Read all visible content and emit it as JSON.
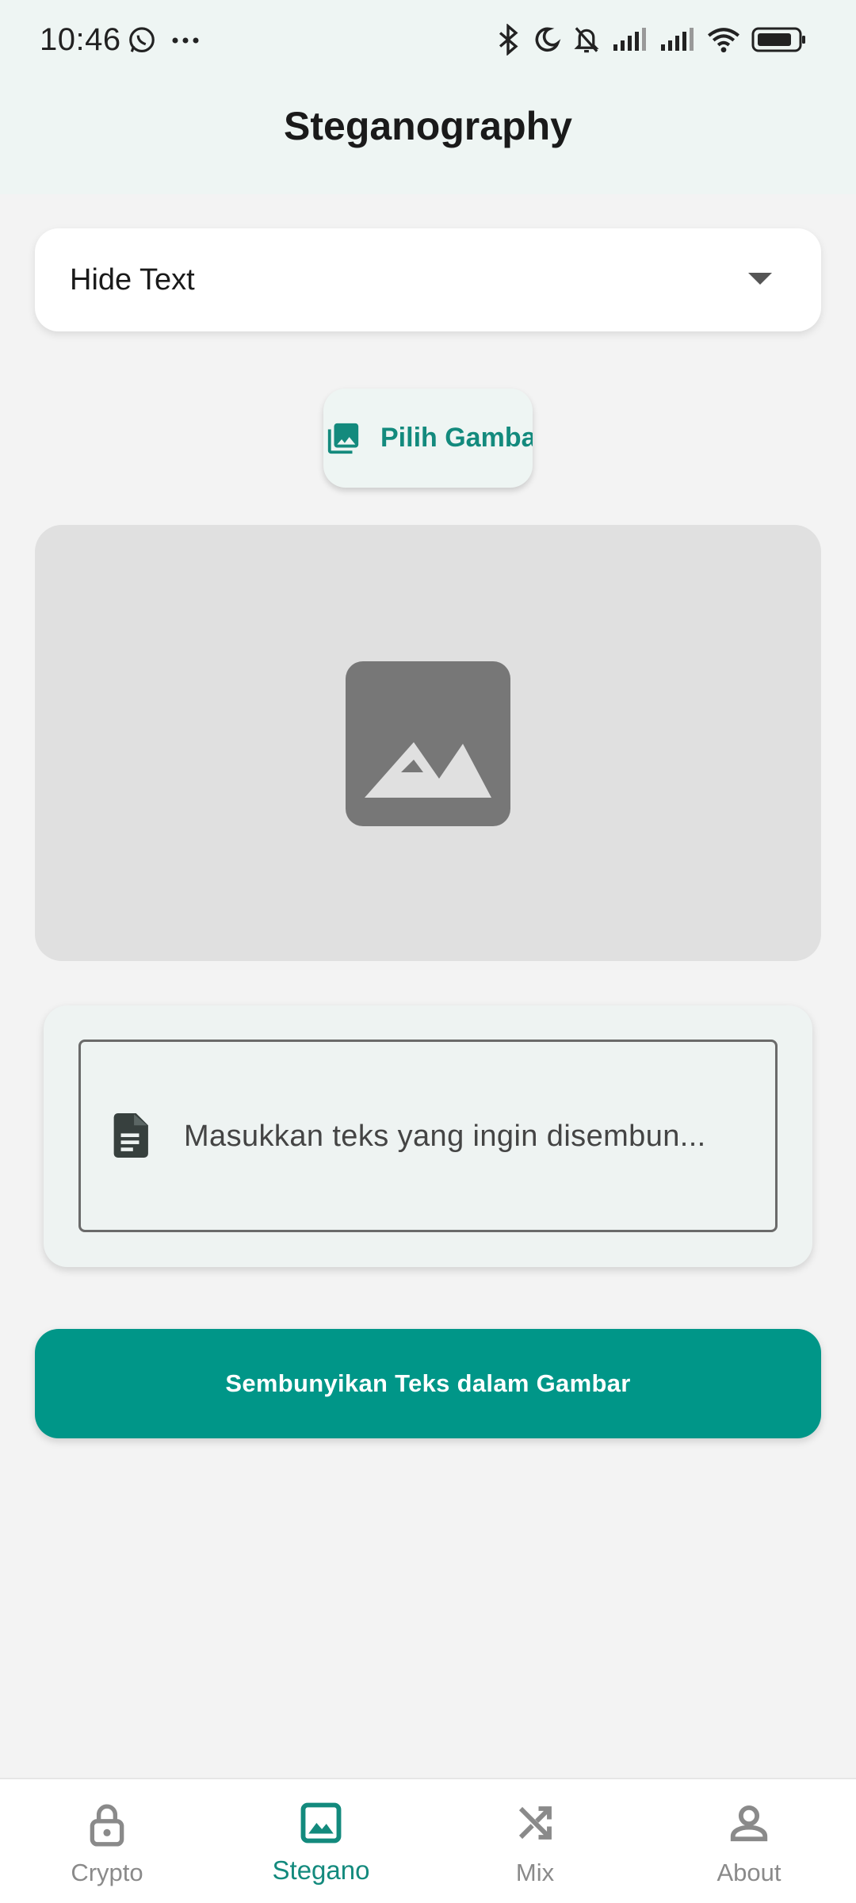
{
  "status_bar": {
    "time": "10:46",
    "left_icons": [
      "whatsapp-icon",
      "more-dots-icon"
    ],
    "right_icons": [
      "bluetooth-icon",
      "moon-icon",
      "bell-off-icon",
      "signal-icon",
      "signal-icon",
      "wifi-icon",
      "battery-icon"
    ]
  },
  "app_bar": {
    "title": "Steganography"
  },
  "mode_dropdown": {
    "selected": "Hide Text"
  },
  "pick_image_button": {
    "label": "Pilih Gambar",
    "icon": "photo-library-icon"
  },
  "image_preview": {
    "icon": "image-placeholder-icon"
  },
  "text_input": {
    "placeholder": "Masukkan teks yang ingin disembun...",
    "icon": "document-icon"
  },
  "action_button": {
    "label": "Sembunyikan Teks dalam Gambar"
  },
  "bottom_nav": {
    "items": [
      {
        "label": "Crypto",
        "icon": "lock-icon",
        "active": false
      },
      {
        "label": "Stegano",
        "icon": "image-icon",
        "active": true
      },
      {
        "label": "Mix",
        "icon": "shuffle-icon",
        "active": false
      },
      {
        "label": "About",
        "icon": "person-icon",
        "active": false
      }
    ]
  },
  "colors": {
    "accent": "#009688",
    "accent_text": "#138a7d",
    "background": "#f3f3f3",
    "top_bar": "#eef5f3",
    "preview_bg": "#e0e0e0",
    "inactive_nav": "#8a8a8a"
  }
}
